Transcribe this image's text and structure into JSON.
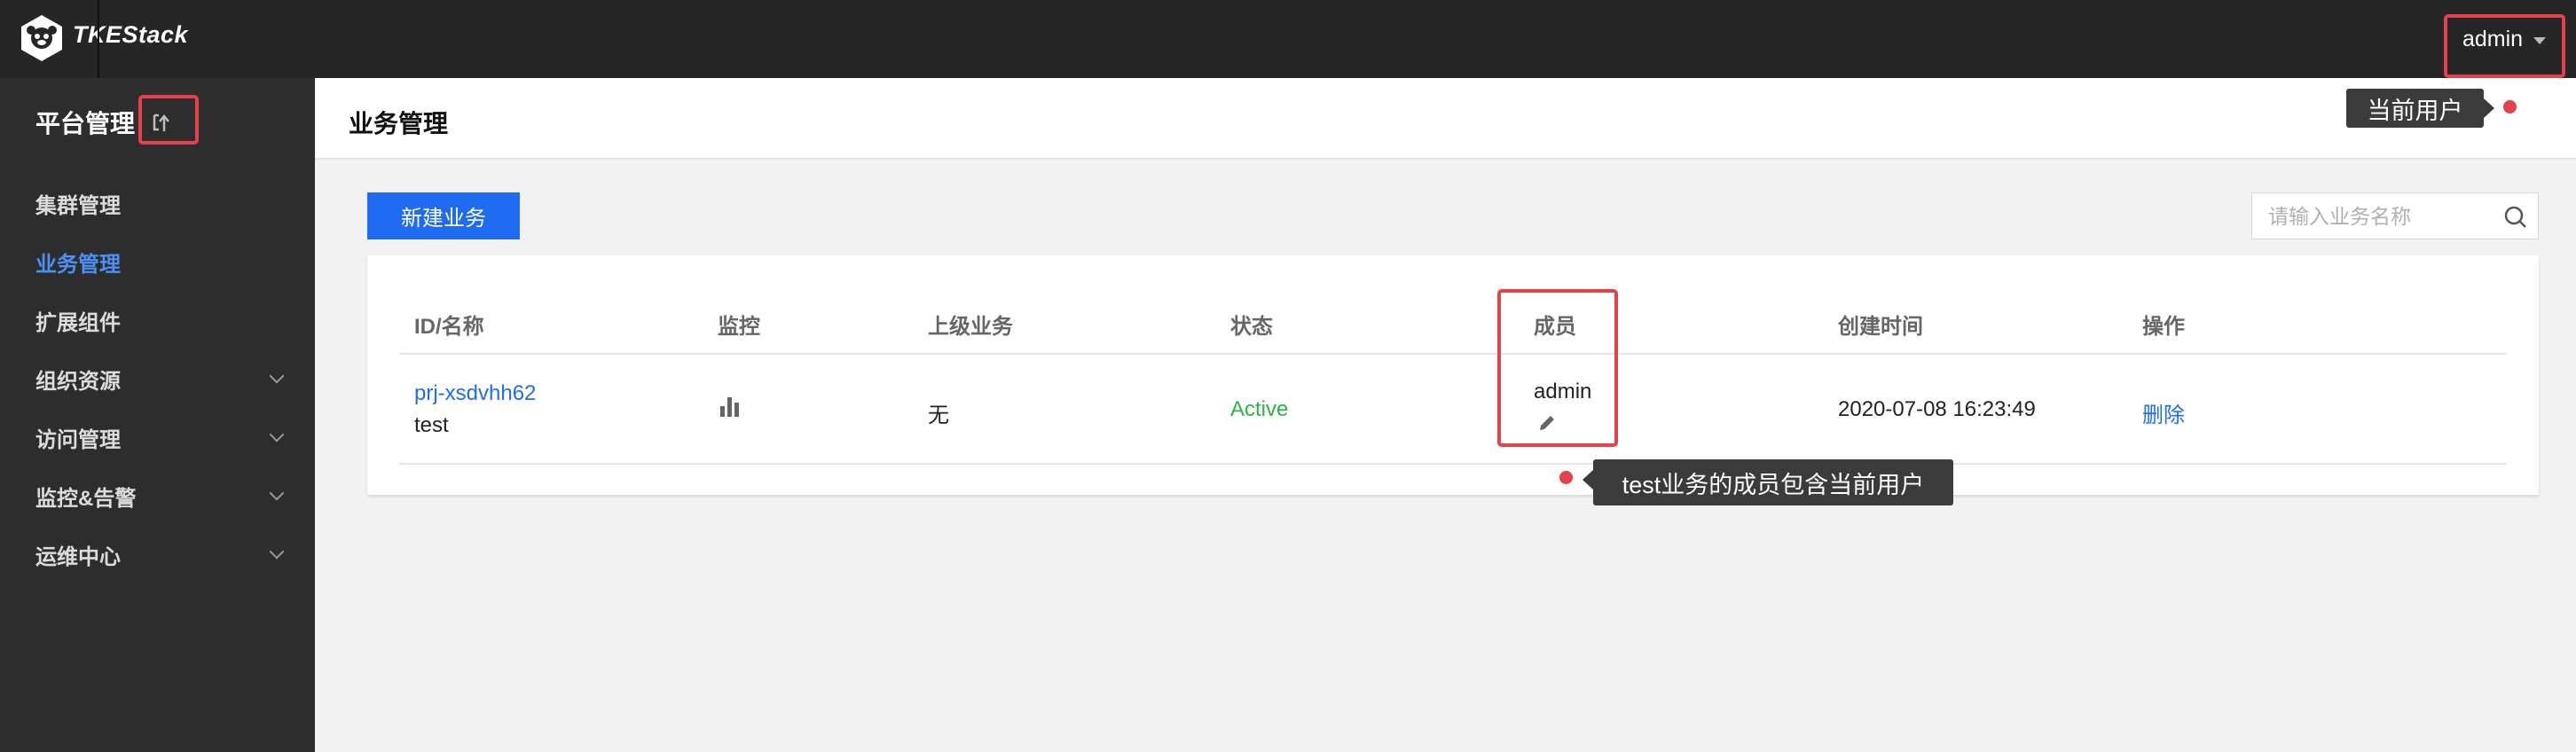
{
  "app": {
    "brand": "TKEStack"
  },
  "user": {
    "name": "admin"
  },
  "sidebar": {
    "title": "平台管理",
    "items": [
      {
        "label": "集群管理",
        "active": false,
        "expandable": false
      },
      {
        "label": "业务管理",
        "active": true,
        "expandable": false
      },
      {
        "label": "扩展组件",
        "active": false,
        "expandable": false
      },
      {
        "label": "组织资源",
        "active": false,
        "expandable": true
      },
      {
        "label": "访问管理",
        "active": false,
        "expandable": true
      },
      {
        "label": "监控&告警",
        "active": false,
        "expandable": true
      },
      {
        "label": "运维中心",
        "active": false,
        "expandable": true
      }
    ]
  },
  "page": {
    "title": "业务管理"
  },
  "toolbar": {
    "create_label": "新建业务",
    "search_placeholder": "请输入业务名称"
  },
  "table": {
    "columns": [
      "ID/名称",
      "监控",
      "上级业务",
      "状态",
      "成员",
      "创建时间",
      "操作"
    ],
    "rows": [
      {
        "id": "prj-xsdvhh62",
        "name": "test",
        "parent": "无",
        "status": "Active",
        "member": "admin",
        "created": "2020-07-08 16:23:49",
        "action": "删除"
      }
    ]
  },
  "annotations": {
    "current_user": "当前用户",
    "member_note": "test业务的成员包含当前用户"
  },
  "colors": {
    "accent": "#1f6cf3",
    "highlight": "#e5404b",
    "active_status": "#2fb344",
    "topbar": "#262626",
    "sidebar": "#2d2d2d"
  },
  "icons": [
    "logo-icon",
    "switch-icon",
    "chevron-down-icon",
    "search-icon",
    "bar-chart-icon",
    "edit-icon",
    "caret-down-icon"
  ]
}
